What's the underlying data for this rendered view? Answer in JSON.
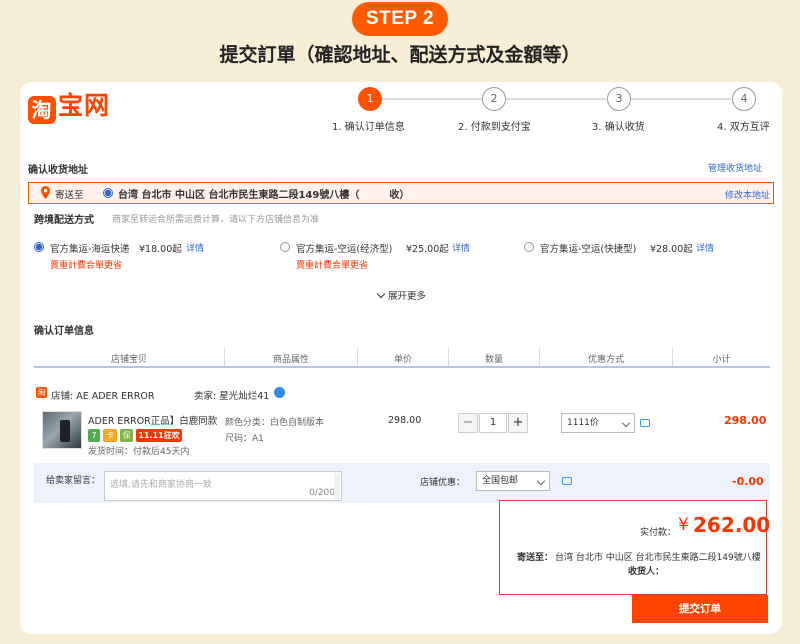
{
  "step_badge": "STEP 2",
  "outer_title": "提交訂單（確認地址、配送方式及金額等）",
  "logo": {
    "icon": "淘",
    "text": "宝网"
  },
  "progress": [
    {
      "num": "1",
      "label": "1. 确认订单信息",
      "active": true
    },
    {
      "num": "2",
      "label": "2. 付款到支付宝",
      "active": false
    },
    {
      "num": "3",
      "label": "3. 确认收货",
      "active": false
    },
    {
      "num": "4",
      "label": "4. 双方互评",
      "active": false
    }
  ],
  "address": {
    "section_title": "确认收货地址",
    "manage_link": "管理收货地址",
    "ship_to": "寄送至",
    "address_text": "台湾 台北市 中山区 台北市民生東路二段149號八樓（　　　收）",
    "edit_link": "修改本地址"
  },
  "shipping": {
    "title": "跨境配送方式",
    "hint": "商家至转运合所需运费计算，请以下方店铺信息为准",
    "options": [
      {
        "label": "官方集运-海运快递",
        "price": "¥18.00起",
        "detail": "详情",
        "note": "賣重計費合單更省",
        "selected": true
      },
      {
        "label": "官方集运-空运(经济型)",
        "price": "¥25.00起",
        "detail": "详情",
        "note": "賣重計費合單更省",
        "selected": false
      },
      {
        "label": "官方集运-空运(快捷型)",
        "price": "¥28.00起",
        "detail": "详情",
        "note": "",
        "selected": false
      }
    ],
    "expand": "展开更多"
  },
  "order": {
    "title": "确认订单信息",
    "headers": [
      "店铺宝贝",
      "商品属性",
      "单价",
      "数量",
      "优惠方式",
      "小计"
    ],
    "shop_icon": "淘",
    "shop_label": "店铺: AE ADER ERROR",
    "seller_label": "卖家: 星光灿烂41",
    "item": {
      "name": "ADER ERROR正品】白鹿同款...",
      "badges": [
        "7",
        "卡",
        "保",
        "11.11狂欢"
      ],
      "ship_time": "发货时间：付款后45天内",
      "attr_color": "颜色分类：白色自制版本",
      "attr_size": "尺码：A1",
      "unit_price": "298.00",
      "qty": "1",
      "discount": "1111价",
      "subtotal": "298.00"
    },
    "message_label": "给卖家留言：",
    "message_placeholder": "选填,请先和商家协商一致",
    "message_count": "0/200",
    "shop_discount_label": "店铺优惠：",
    "shop_discount_value": "全国包邮",
    "shop_discount_amount": "-0.00"
  },
  "summary": {
    "paid_label": "实付款：",
    "currency": "¥",
    "amount": "262.00",
    "ship_to_label": "寄送至：",
    "ship_to_value": "台湾 台北市 中山区 台北市民生東路二段149號八樓",
    "receiver_label": "收货人："
  },
  "submit_label": "提交订单",
  "colors": {
    "accent": "#ff5000",
    "price": "#ff3300",
    "link": "#3366cc",
    "background": "#f6efd6"
  }
}
